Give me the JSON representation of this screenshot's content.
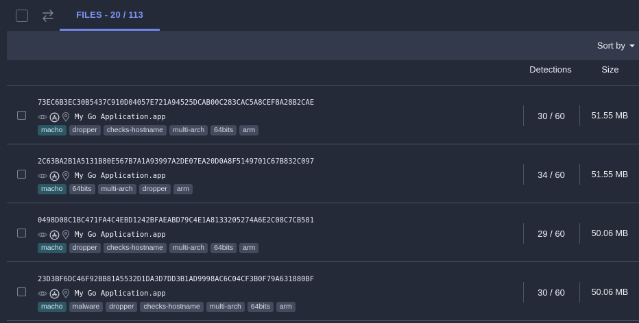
{
  "tabs": {
    "files_label": "FILES - 20 / 113"
  },
  "sort": {
    "label": "Sort by"
  },
  "columns": {
    "detections": "Detections",
    "size": "Size"
  },
  "colors": {
    "accent": "#6e86ea",
    "tag_highlight": "#2c5866",
    "background": "#252a38"
  },
  "rows": [
    {
      "hash": "73EC6B3EC30B5437C910D04057E721A94525DCAB00C283CAC5A8CEF8A28B2CAE",
      "filename": "My Go Application.app",
      "tags": [
        "macho",
        "dropper",
        "checks-hostname",
        "multi-arch",
        "64bits",
        "arm"
      ],
      "detections": "30 / 60",
      "size": "51.55 MB"
    },
    {
      "hash": "2C63BA2B1A5131B80E567B7A1A93997A2DE07EA20D0A8F5149701C67B832C097",
      "filename": "My Go Application.app",
      "tags": [
        "macho",
        "64bits",
        "multi-arch",
        "dropper",
        "arm"
      ],
      "detections": "34 / 60",
      "size": "51.55 MB"
    },
    {
      "hash": "0498D08C1BC471FA4C4EBD1242BFAEABD79C4E1A8133205274A6E2C08C7CB581",
      "filename": "My Go Application.app",
      "tags": [
        "macho",
        "dropper",
        "checks-hostname",
        "multi-arch",
        "64bits",
        "arm"
      ],
      "detections": "29 / 60",
      "size": "50.06 MB"
    },
    {
      "hash": "23D3BF6DC46F92BB81A5532D1DA3D7DD3B1AD9998AC6C04CF3B0F79A631880BF",
      "filename": "My Go Application.app",
      "tags": [
        "macho",
        "malware",
        "dropper",
        "checks-hostname",
        "multi-arch",
        "64bits",
        "arm"
      ],
      "detections": "30 / 60",
      "size": "50.06 MB"
    }
  ]
}
